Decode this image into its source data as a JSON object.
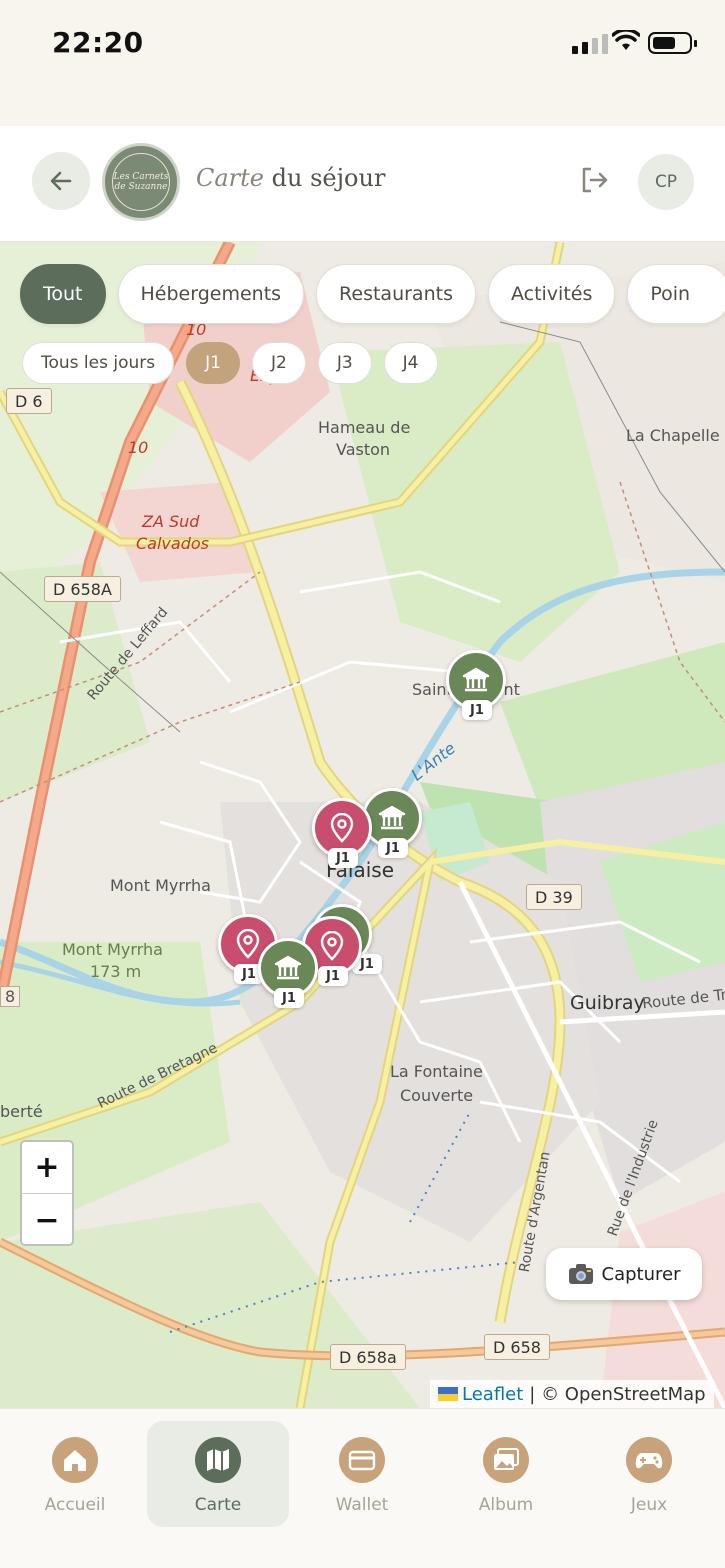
{
  "status": {
    "time": "22:20"
  },
  "header": {
    "title_italic": "Carte",
    "title_rest": " du séjour",
    "avatar_initials": "CP",
    "logo_text": "Les Carnets de Suzanne"
  },
  "filters": {
    "categories": [
      "Tout",
      "Hébergements",
      "Restaurants",
      "Activités",
      "Poin"
    ],
    "active_category": "Tout",
    "days": [
      "Tous les jours",
      "J1",
      "J2",
      "J3",
      "J4"
    ],
    "active_day": "J1"
  },
  "map": {
    "labels": {
      "hameau": "Hameau de",
      "vaston": "Vaston",
      "chapelle": "La Chapelle",
      "za1": "ZA Sud",
      "za2": "Calvados",
      "saint": "Saint-Laurent",
      "ante": "L'Ante",
      "falaise": "Falaise",
      "mont": "Mont Myrrha",
      "mont2": "Mont Myrrha",
      "alt": "173 m",
      "guibray": "Guibray",
      "fontaine1": "La Fontaine",
      "fontaine2": "Couverte",
      "berte": "berté",
      "leffard": "Route de Leffard",
      "bretagne": "Route de Bretagne",
      "argentan": "Route d'Argentan",
      "industrie": "Rue de l'Industrie",
      "routetr": "Route de Tr",
      "exp": "Exp",
      "r10a": "10",
      "r10b": "10",
      "r8": "8"
    },
    "road_tags": [
      "D 6",
      "D 658A",
      "D 39",
      "D 658a",
      "D 658"
    ],
    "markers": [
      {
        "type": "museum",
        "color": "green",
        "day": "J1"
      },
      {
        "type": "museum",
        "color": "green",
        "day": "J1"
      },
      {
        "type": "pin",
        "color": "red",
        "day": "J1"
      },
      {
        "type": "museum",
        "color": "green",
        "day": "J1"
      },
      {
        "type": "pin",
        "color": "red",
        "day": "J1"
      },
      {
        "type": "pin",
        "color": "red",
        "day": "J1"
      },
      {
        "type": "museum",
        "color": "green",
        "day": "J1"
      }
    ],
    "zoom_in": "+",
    "zoom_out": "−",
    "capture_label": "Capturer",
    "capture_icon": "camera-icon",
    "attribution_leaflet": "Leaflet",
    "attribution_osm": "| © OpenStreetMap"
  },
  "tabbar": {
    "items": [
      {
        "label": "Accueil",
        "icon": "home-icon"
      },
      {
        "label": "Carte",
        "icon": "map-icon"
      },
      {
        "label": "Wallet",
        "icon": "card-icon"
      },
      {
        "label": "Album",
        "icon": "photos-icon"
      },
      {
        "label": "Jeux",
        "icon": "gamepad-icon"
      }
    ],
    "active": "Carte"
  },
  "colors": {
    "primary": "#5c6d5b",
    "accent": "#c2a37c",
    "marker_green": "#6a8757",
    "marker_red": "#c94d6d"
  }
}
